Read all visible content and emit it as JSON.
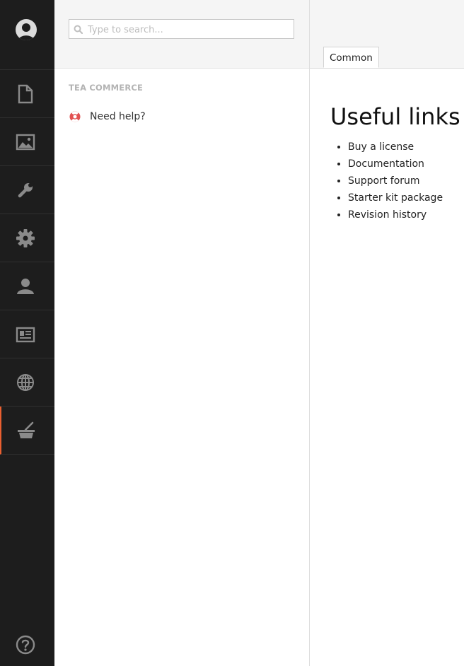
{
  "search": {
    "placeholder": "Type to search..."
  },
  "tree": {
    "title": "TEA COMMERCE",
    "nodes": [
      {
        "label": "Need help?",
        "icon": "lifebuoy-icon"
      }
    ]
  },
  "editor": {
    "tabs": [
      {
        "label": "Common"
      }
    ],
    "heading": "Useful links",
    "links": [
      "Buy a license",
      "Documentation",
      "Support forum",
      "Starter kit package",
      "Revision history"
    ]
  },
  "sections": [
    {
      "icon": "document-icon"
    },
    {
      "icon": "image-icon"
    },
    {
      "icon": "wrench-icon"
    },
    {
      "icon": "gear-icon"
    },
    {
      "icon": "user-icon"
    },
    {
      "icon": "id-card-icon"
    },
    {
      "icon": "globe-icon"
    },
    {
      "icon": "basket-icon",
      "active": true
    }
  ],
  "colors": {
    "rail": "#1d1d1d",
    "accent": "#e95f30",
    "icon": "#8a8a8a"
  }
}
